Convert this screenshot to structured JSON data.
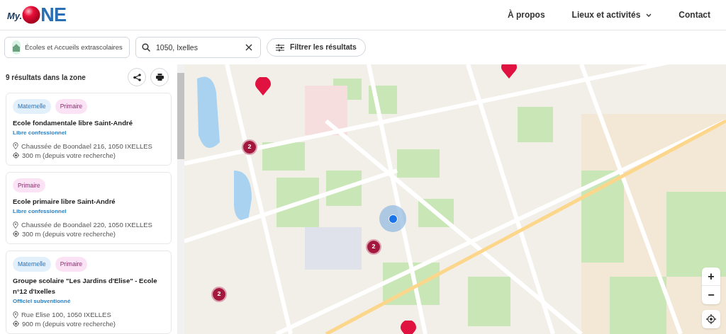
{
  "header": {
    "logo": {
      "prefix": "My.",
      "suffix": "NE"
    },
    "nav": [
      {
        "label": "À propos",
        "dropdown": false
      },
      {
        "label": "Lieux et activités",
        "dropdown": true
      },
      {
        "label": "Contact",
        "dropdown": false
      }
    ]
  },
  "toolbar": {
    "category": "Écoles et Accueils extrascolaires",
    "search": {
      "value": "1050, Ixelles"
    },
    "filter_button": "Filtrer les résultats"
  },
  "results": {
    "count_label": "9 résultats dans la zone",
    "items": [
      {
        "tags": [
          {
            "label": "Maternelle",
            "kind": "maternelle"
          },
          {
            "label": "Primaire",
            "kind": "primaire"
          }
        ],
        "name": "Ecole fondamentale libre Saint-André",
        "network": "Libre confessionnel",
        "address": "Chaussée de Boondael 216, 1050 IXELLES",
        "distance": "300 m (depuis votre recherche)"
      },
      {
        "tags": [
          {
            "label": "Primaire",
            "kind": "primaire"
          }
        ],
        "name": "Ecole primaire libre Saint-André",
        "network": "Libre confessionnel",
        "address": "Chaussée de Boondael 220, 1050 IXELLES",
        "distance": "300 m (depuis votre recherche)"
      },
      {
        "tags": [
          {
            "label": "Maternelle",
            "kind": "maternelle"
          },
          {
            "label": "Primaire",
            "kind": "primaire"
          }
        ],
        "name": "Groupe scolaire \"Les Jardins d'Elise\" - Ecole n°12 d'Ixelles",
        "network": "Officiel subventionné",
        "address": "Rue Elise 100, 1050 IXELLES",
        "distance": "900 m (depuis votre recherche)"
      }
    ]
  },
  "map": {
    "markers": [
      {
        "kind": "cluster",
        "count": "2"
      },
      {
        "kind": "cluster",
        "count": "2"
      },
      {
        "kind": "cluster",
        "count": "2"
      },
      {
        "kind": "pin"
      },
      {
        "kind": "pin"
      },
      {
        "kind": "pin"
      },
      {
        "kind": "location"
      }
    ],
    "controls": {
      "zoom_in": "+",
      "zoom_out": "−"
    }
  }
}
